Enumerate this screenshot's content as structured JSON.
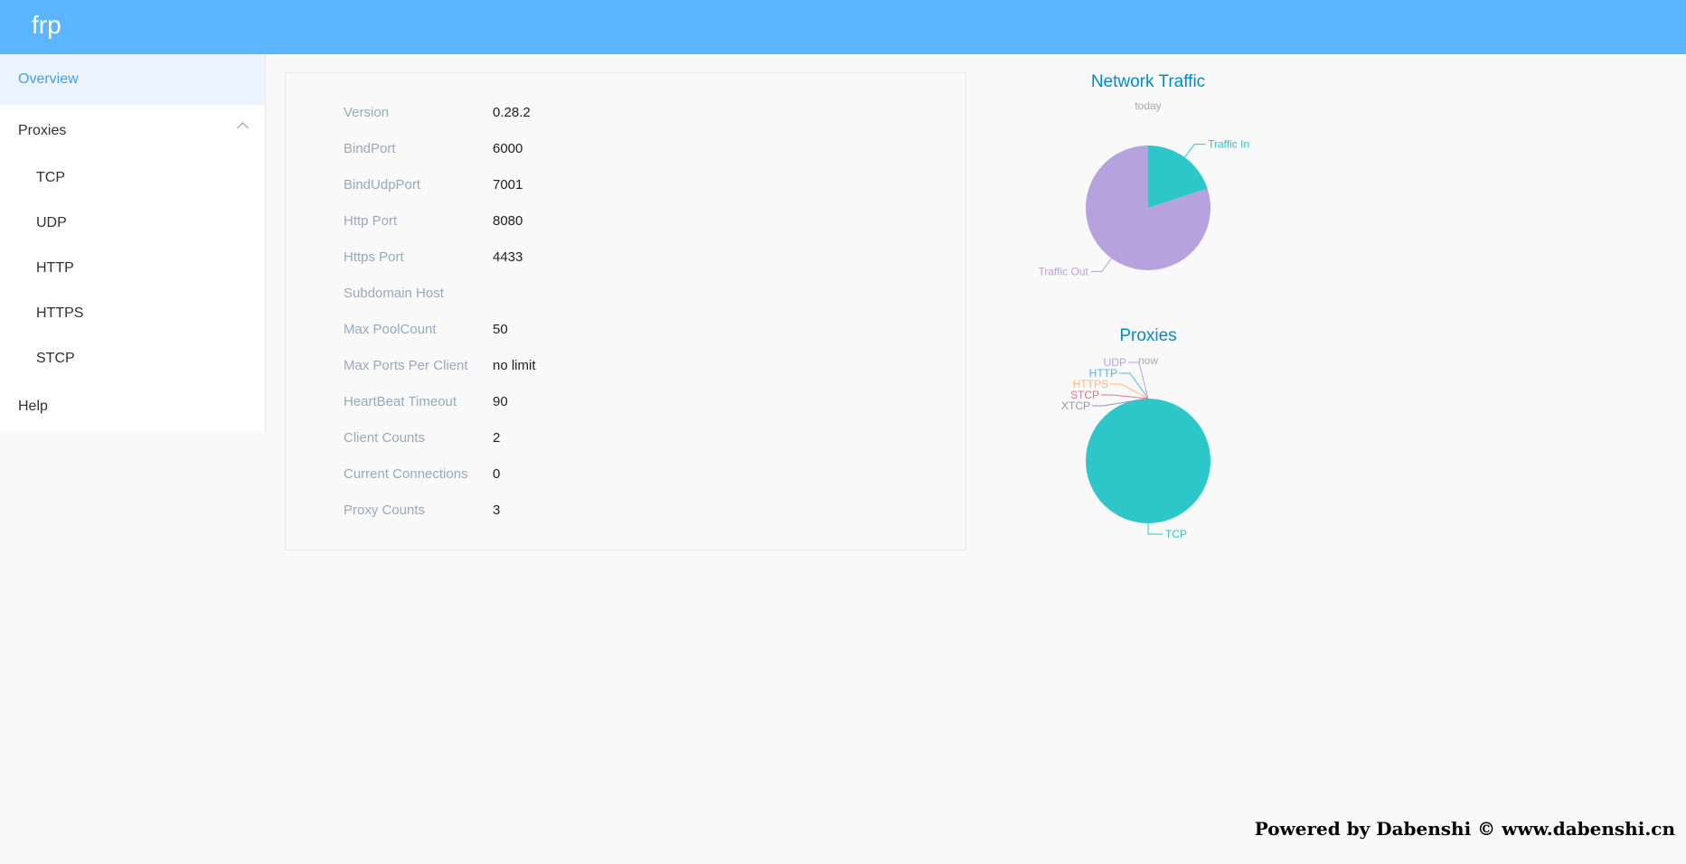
{
  "header": {
    "brand": "frp"
  },
  "sidebar": {
    "overview": "Overview",
    "proxies": "Proxies",
    "proxy_items": [
      "TCP",
      "UDP",
      "HTTP",
      "HTTPS",
      "STCP"
    ],
    "help": "Help"
  },
  "server_info": [
    {
      "label": "Version",
      "value": "0.28.2"
    },
    {
      "label": "BindPort",
      "value": "6000"
    },
    {
      "label": "BindUdpPort",
      "value": "7001"
    },
    {
      "label": "Http Port",
      "value": "8080"
    },
    {
      "label": "Https Port",
      "value": "4433"
    },
    {
      "label": "Subdomain Host",
      "value": ""
    },
    {
      "label": "Max PoolCount",
      "value": "50"
    },
    {
      "label": "Max Ports Per Client",
      "value": "no limit"
    },
    {
      "label": "HeartBeat Timeout",
      "value": "90"
    },
    {
      "label": "Client Counts",
      "value": "2"
    },
    {
      "label": "Current Connections",
      "value": "0"
    },
    {
      "label": "Proxy Counts",
      "value": "3"
    }
  ],
  "chart_data": [
    {
      "type": "pie",
      "title": "Network Traffic",
      "subtitle": "today",
      "slices": [
        {
          "name": "Traffic In",
          "value": 20,
          "color": "#2ec7c9"
        },
        {
          "name": "Traffic Out",
          "value": 80,
          "color": "#b6a2de"
        }
      ]
    },
    {
      "type": "pie",
      "title": "Proxies",
      "subtitle": "now",
      "slices": [
        {
          "name": "TCP",
          "value": 3,
          "color": "#2ec7c9"
        },
        {
          "name": "UDP",
          "value": 0,
          "color": "#b6a2de"
        },
        {
          "name": "HTTP",
          "value": 0,
          "color": "#5ab1ef"
        },
        {
          "name": "HTTPS",
          "value": 0,
          "color": "#ffb980"
        },
        {
          "name": "STCP",
          "value": 0,
          "color": "#d87a80"
        },
        {
          "name": "XTCP",
          "value": 0,
          "color": "#8d98b3"
        }
      ]
    }
  ],
  "footer": {
    "text": "Powered by Dabenshi © www.dabenshi.cn"
  },
  "colors": {
    "header": "#5cb6ff",
    "active": "#409eff",
    "title": "#008acd"
  }
}
